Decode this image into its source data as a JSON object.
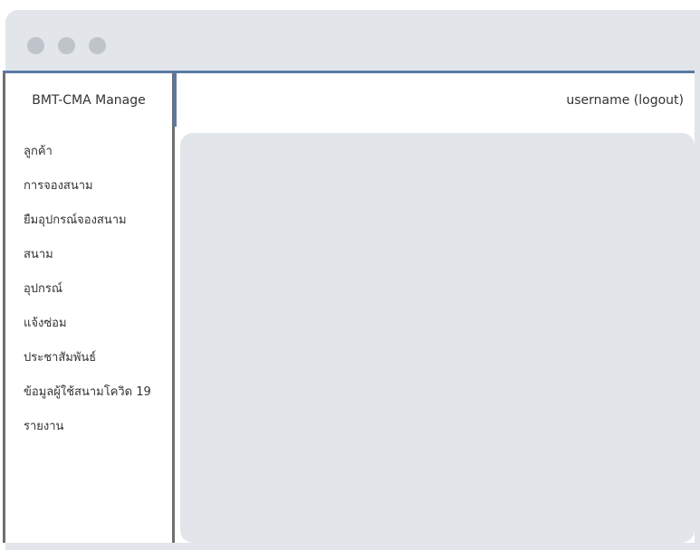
{
  "app": {
    "brand": "BMT-CMA Manage"
  },
  "header": {
    "user_label": "username (logout)"
  },
  "sidebar": {
    "items": [
      {
        "label": "ลูกค้า"
      },
      {
        "label": "การจองสนาม"
      },
      {
        "label": "ยืมอุปกรณ์จองสนาม"
      },
      {
        "label": "สนาม"
      },
      {
        "label": "อุปกรณ์"
      },
      {
        "label": "แจ้งซ่อม"
      },
      {
        "label": "ประชาสัมพันธ์"
      },
      {
        "label": "ข้อมูลผู้ใช้สนามโควิด 19"
      },
      {
        "label": "รายงาน"
      }
    ]
  },
  "colors": {
    "window_bg": "#e2e6eb",
    "window_dot": "#bfc4cb",
    "border": "#6e6f71",
    "accent_border": "#5b7aa5"
  }
}
